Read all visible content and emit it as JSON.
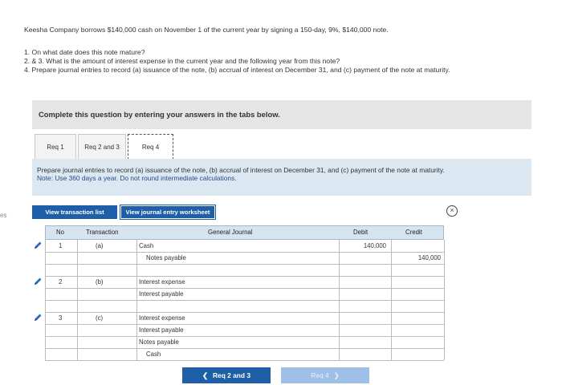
{
  "edge_text": "es",
  "problem": {
    "intro": "Keesha Company borrows $140,000 cash on November 1 of the current year by signing a 150-day, 9%, $140,000 note.",
    "q1": "1. On what date does this note mature?",
    "q2": "2. & 3. What is the amount of interest expense in the current year and the following year from this note?",
    "q4": "4. Prepare journal entries to record (a) issuance of the note, (b) accrual of interest on December 31, and (c) payment of the note at maturity."
  },
  "complete_box": "Complete this question by entering your answers in the tabs below.",
  "tabs": [
    {
      "label": "Req 1"
    },
    {
      "label": "Req 2 and 3"
    },
    {
      "label": "Req 4"
    }
  ],
  "instruction": {
    "text": "Prepare journal entries to record (a) issuance of the note, (b) accrual of interest on December 31, and (c) payment of the note at maturity.",
    "note": "Note: Use 360 days a year. Do not round intermediate calculations."
  },
  "buttons": {
    "view_list": "View transaction list",
    "view_worksheet": "View journal entry worksheet",
    "close": "×",
    "prev": "Req 2 and 3",
    "next": "Req 4"
  },
  "journal": {
    "headers": {
      "no": "No",
      "transaction": "Transaction",
      "general_journal": "General Journal",
      "debit": "Debit",
      "credit": "Credit"
    },
    "entries": [
      {
        "no": "1",
        "transaction": "(a)",
        "lines": [
          {
            "account": "Cash",
            "indent": false,
            "debit": "140,000",
            "credit": ""
          },
          {
            "account": "Notes payable",
            "indent": true,
            "debit": "",
            "credit": "140,000"
          }
        ]
      },
      {
        "no": "2",
        "transaction": "(b)",
        "lines": [
          {
            "account": "Interest expense",
            "indent": false,
            "debit": "",
            "credit": ""
          },
          {
            "account": "Interest payable",
            "indent": false,
            "debit": "",
            "credit": ""
          }
        ]
      },
      {
        "no": "3",
        "transaction": "(c)",
        "lines": [
          {
            "account": "Interest expense",
            "indent": false,
            "debit": "",
            "credit": ""
          },
          {
            "account": "Interest payable",
            "indent": false,
            "debit": "",
            "credit": ""
          },
          {
            "account": "Notes payable",
            "indent": false,
            "debit": "",
            "credit": ""
          },
          {
            "account": "Cash",
            "indent": true,
            "debit": "",
            "credit": ""
          }
        ]
      }
    ]
  },
  "colors": {
    "accent": "#1f5fa8",
    "header_bg": "#d6e4f0",
    "instruction_bg": "#dbe8f2",
    "panel_bg": "#e5e5e5"
  }
}
